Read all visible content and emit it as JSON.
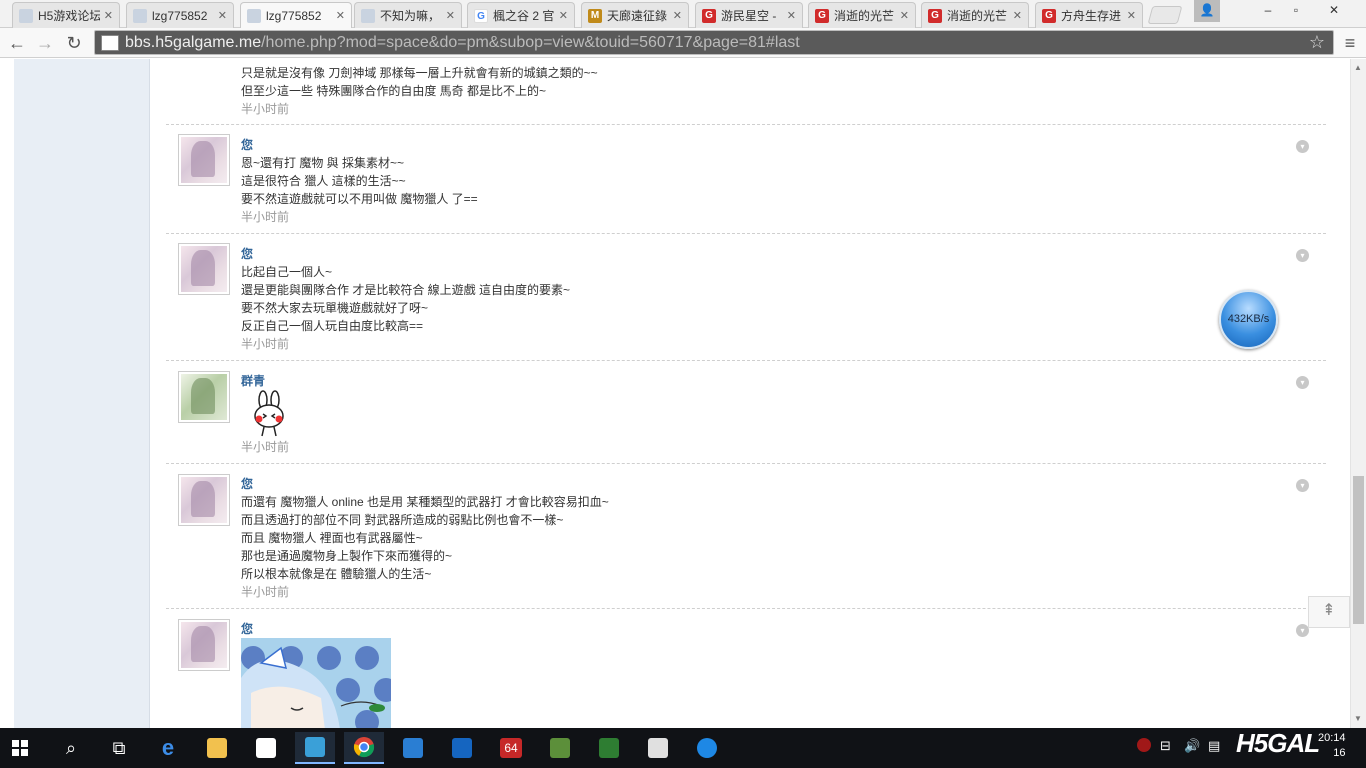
{
  "browser": {
    "tabs": [
      {
        "title": "H5游戏论坛",
        "favicon": "avatar",
        "active": false
      },
      {
        "title": "lzg775852",
        "favicon": "avatar",
        "active": false
      },
      {
        "title": "lzg775852",
        "favicon": "avatar",
        "active": true
      },
      {
        "title": "不知为嘛，",
        "favicon": "avatar",
        "active": false
      },
      {
        "title": "楓之谷 2 官",
        "favicon": "google",
        "active": false
      },
      {
        "title": "天廊遠征錄",
        "favicon": "mhp",
        "active": false
      },
      {
        "title": "游民星空 -",
        "favicon": "g-red",
        "active": false
      },
      {
        "title": "消逝的光芒",
        "favicon": "g-red",
        "active": false
      },
      {
        "title": "消逝的光芒",
        "favicon": "g-red",
        "active": false
      },
      {
        "title": "方舟生存进",
        "favicon": "g-red",
        "active": false
      }
    ],
    "url_host": "bbs.h5galgame.me",
    "url_path": "/home.php?mod=space&do=pm&subop=view&touid=560717&page=81#last"
  },
  "messages": [
    {
      "author": "",
      "lines": [
        "只是就是沒有像 刀劍神域 那樣每一層上升就會有新的城鎮之類的~~",
        "但至少這一些 特殊團隊合作的自由度 馬奇 都是比不上的~"
      ],
      "time": "半小时前",
      "avatar": "self"
    },
    {
      "author": "您",
      "lines": [
        "恩~還有打 魔物 與 採集素材~~",
        "這是很符合 獵人 這樣的生活~~",
        "要不然這遊戲就可以不用叫做 魔物獵人 了=="
      ],
      "time": "半小时前",
      "avatar": "self"
    },
    {
      "author": "您",
      "lines": [
        "比起自己一個人~",
        "還是更能與團隊合作 才是比較符合 線上遊戲 這自由度的要素~",
        "要不然大家去玩單機遊戲就好了呀~",
        "反正自己一個人玩自由度比較高=="
      ],
      "time": "半小时前",
      "avatar": "self"
    },
    {
      "author": "群青",
      "lines": [],
      "time": "半小时前",
      "avatar": "other",
      "sticker": "rabbit"
    },
    {
      "author": "您",
      "lines": [
        "而還有 魔物獵人 online 也是用 某種類型的武器打 才會比較容易扣血~",
        "而且透過打的部位不同 對武器所造成的弱點比例也會不一樣~",
        "而且 魔物獵人 裡面也有武器屬性~",
        "那也是通過魔物身上製作下來而獲得的~",
        "所以根本就像是在 體驗獵人的生活~"
      ],
      "time": "半小时前",
      "avatar": "self"
    },
    {
      "author": "您",
      "lines": [],
      "time": "",
      "avatar": "self",
      "sticker": "anime"
    }
  ],
  "speed_widget": "432KB/s",
  "taskbar": {
    "clock_time": "20:14",
    "clock_date": "16",
    "watermark": "H5GAL"
  },
  "colors": {
    "author": "#336699",
    "time": "#999999",
    "sidebar": "#e8eef5",
    "taskbar": "#101216"
  },
  "icons": {
    "options": "chevron-down-icon",
    "back_to_top": "arrow-up-icon"
  }
}
